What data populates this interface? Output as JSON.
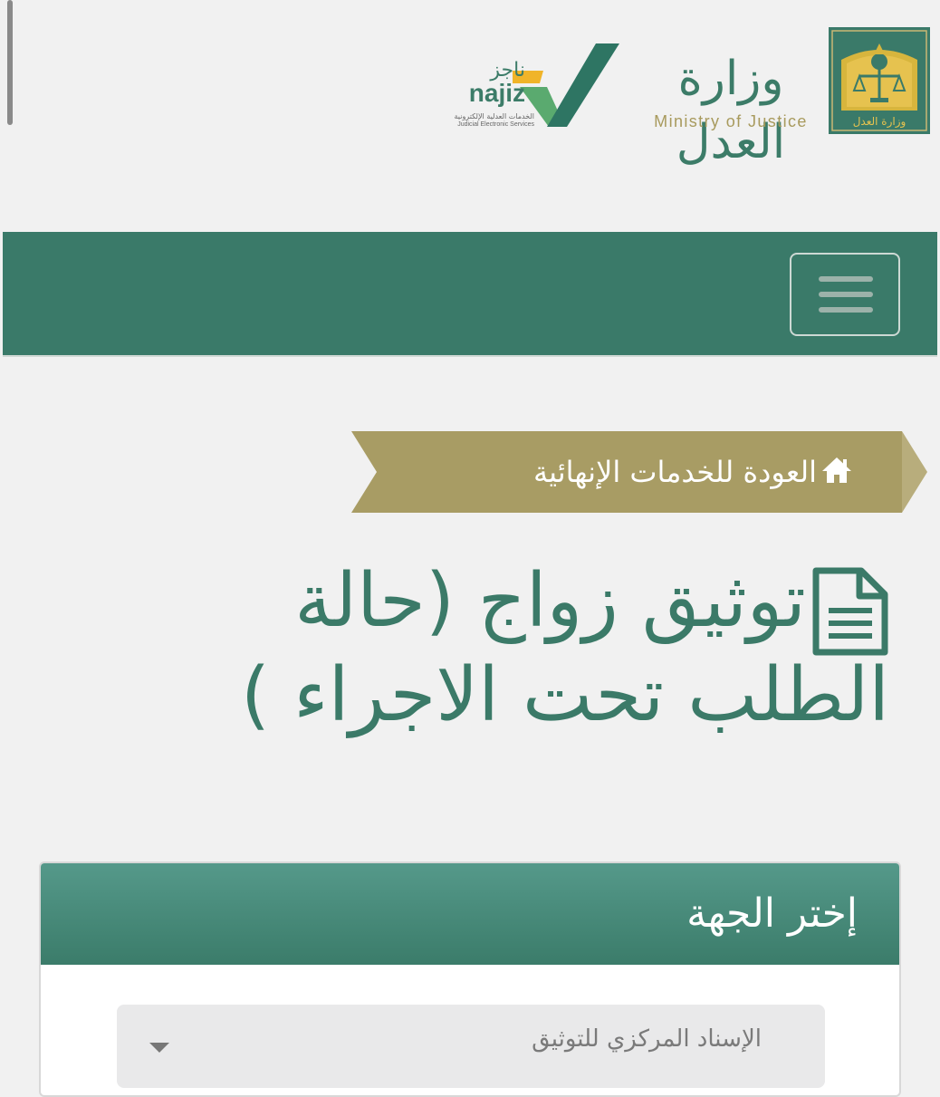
{
  "header": {
    "moj_name_ar": "وزارة العدل",
    "moj_name_en": "Ministry of Justice",
    "najiz_name_ar": "ناجز",
    "najiz_name_en": "najiz",
    "najiz_tagline_ar": "الخدمات العدلية الإلكترونية",
    "najiz_tagline_en": "Judicial Electronic Services"
  },
  "navbar": {
    "menu_icon": "hamburger-icon"
  },
  "breadcrumb": {
    "icon": "home-icon",
    "label": "العودة للخدمات الإنهائية"
  },
  "page": {
    "title_icon": "document-icon",
    "title_line1": "توثيق زواج (حالة",
    "title_line2": "الطلب تحت الاجراء )"
  },
  "panel": {
    "title": "إختر الجهة",
    "select": {
      "value": "الإسناد المركزي للتوثيق",
      "icon": "caret-down-icon"
    }
  },
  "colors": {
    "primary_green": "#3a7a69",
    "gold": "#a89a5d",
    "background": "#f1f1f1"
  }
}
